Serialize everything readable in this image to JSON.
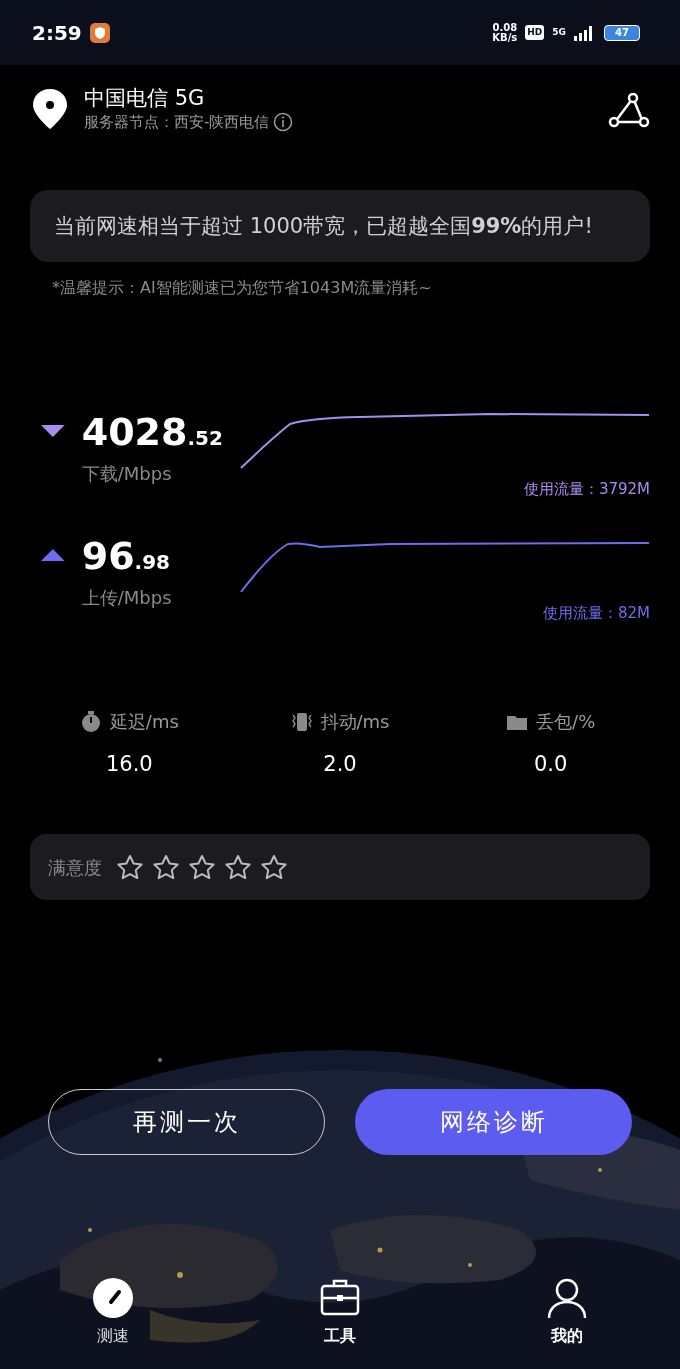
{
  "status_bar": {
    "time": "2:59",
    "net_speed": "0.08",
    "net_unit": "KB/s",
    "hd": "HD",
    "network": "5G",
    "battery": "47"
  },
  "header": {
    "carrier": "中国电信 5G",
    "server": "服务器节点：西安-陕西电信"
  },
  "result_card": {
    "text": "当前网速相当于超过 1000带宽，已超越全国**99%**的用户!"
  },
  "tip": "*温馨提示：AI智能测速已为您节省1043M流量消耗~",
  "speeds": [
    {
      "kind": "download",
      "value": "4028.52",
      "label": "下载/Mbps",
      "usage": "使用流量：3792M",
      "color": "#a98cf0"
    },
    {
      "kind": "upload",
      "value": "96.98",
      "label": "上传/Mbps",
      "usage": "使用流量：82M",
      "color": "#6f6cf0"
    }
  ],
  "metrics": [
    {
      "kind": "latency",
      "label": "延迟/ms",
      "value": "16.0"
    },
    {
      "kind": "jitter",
      "label": "抖动/ms",
      "value": "2.0"
    },
    {
      "kind": "loss",
      "label": "丢包/%",
      "value": "0.0"
    }
  ],
  "rating": {
    "label": "满意度",
    "stars": 0
  },
  "buttons": [
    {
      "kind": "outline",
      "label": "再测一次"
    },
    {
      "kind": "primary",
      "label": "网络诊断"
    }
  ],
  "bottom_nav": [
    {
      "kind": "speed",
      "label": "测速",
      "selected": true
    },
    {
      "kind": "tools",
      "label": "工具",
      "selected": false
    },
    {
      "kind": "profile",
      "label": "我的",
      "selected": false
    }
  ]
}
